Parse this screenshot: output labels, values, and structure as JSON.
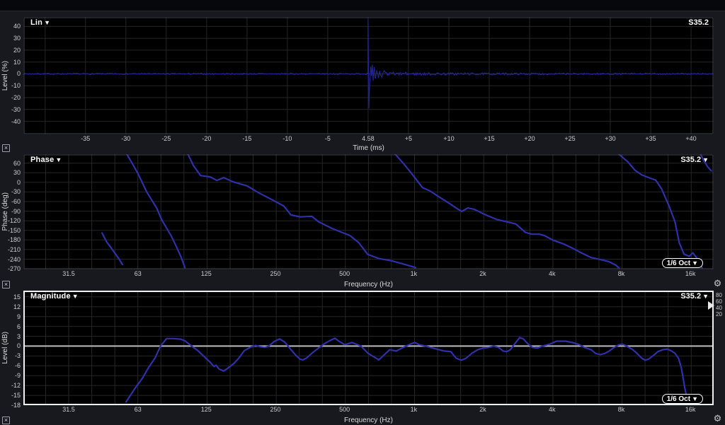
{
  "app": {
    "trace_label": "S35.2",
    "smoothing_label": "1/6 Oct",
    "glyphs": {
      "dropdown": "▼",
      "close": "×",
      "gear": "⚙"
    },
    "colors": {
      "grid": "#262626",
      "plot_border": "#41464e",
      "active_border": "#f0f0f0",
      "zero_line": "#bdbdbd",
      "ir_trace": "#24249c",
      "freq_trace": "#3030a8"
    }
  },
  "panels": {
    "ir": {
      "title": "Lin",
      "xlabel": "Time (ms)",
      "ylabel": "Level (%)",
      "trace": "S35.2"
    },
    "phase": {
      "title": "Phase",
      "xlabel": "Frequency (Hz)",
      "ylabel": "Phase (deg)",
      "trace": "S35.2",
      "smoothing": "1/6 Oct"
    },
    "magnitude": {
      "title": "Magnitude",
      "xlabel": "Frequency (Hz)",
      "ylabel": "Level (dB)",
      "trace": "S35.2",
      "smoothing": "1/6 Oct",
      "right_scale": [
        "80",
        "60",
        "40",
        "20"
      ]
    }
  },
  "chart_data": [
    {
      "id": "ir",
      "type": "line",
      "title": "Lin (impulse response)",
      "xscale": "linear",
      "xlim": [
        -42.7,
        42.8
      ],
      "ylim": [
        -51,
        48
      ],
      "xlabel": "Time (ms)",
      "ylabel": "Level (%)",
      "grid_x_step": 5,
      "xticks": [
        {
          "v": -35,
          "l": "-35"
        },
        {
          "v": -30,
          "l": "-30"
        },
        {
          "v": -25,
          "l": "-25"
        },
        {
          "v": -20,
          "l": "-20"
        },
        {
          "v": -15,
          "l": "-15"
        },
        {
          "v": -10,
          "l": "-10"
        },
        {
          "v": -5,
          "l": "-5"
        },
        {
          "v": 0,
          "l": "4.58"
        },
        {
          "v": 5,
          "l": "+5"
        },
        {
          "v": 10,
          "l": "+10"
        },
        {
          "v": 15,
          "l": "+15"
        },
        {
          "v": 20,
          "l": "+20"
        },
        {
          "v": 25,
          "l": "+25"
        },
        {
          "v": 30,
          "l": "+30"
        },
        {
          "v": 35,
          "l": "+35"
        },
        {
          "v": 40,
          "l": "+40"
        }
      ],
      "yticks": [
        40,
        30,
        20,
        10,
        0,
        -10,
        -20,
        -30,
        -40
      ],
      "stroke": "#24249c",
      "stroke_width": 1.1,
      "impulse": {
        "seed": 7,
        "dt": 0.09,
        "noise_pre": 0.55,
        "noise_post": 1.15,
        "decay_ms": 14,
        "peak_time_label": "4.58",
        "keypoints": [
          [
            -0.15,
            0
          ],
          [
            -0.02,
            2
          ],
          [
            0,
            46
          ],
          [
            0.05,
            5
          ],
          [
            0.1,
            -29
          ],
          [
            0.18,
            -12
          ],
          [
            0.25,
            -2
          ],
          [
            0.33,
            5
          ],
          [
            0.42,
            -3
          ],
          [
            0.52,
            7
          ],
          [
            0.62,
            -5
          ],
          [
            0.75,
            6
          ],
          [
            0.9,
            -4
          ],
          [
            1.05,
            3
          ],
          [
            1.25,
            -2.5
          ],
          [
            1.45,
            2.5
          ],
          [
            1.7,
            -2
          ],
          [
            2.0,
            2
          ],
          [
            2.4,
            -1.5
          ],
          [
            2.9,
            1.2
          ],
          [
            3.4,
            -1
          ]
        ]
      }
    },
    {
      "id": "phase",
      "type": "line",
      "title": "Phase",
      "xscale": "log",
      "xlim": [
        20,
        20200
      ],
      "ylim": [
        -272,
        88
      ],
      "xlabel": "Frequency (Hz)",
      "ylabel": "Phase (deg)",
      "xticks": [
        {
          "v": 31.5,
          "l": "31.5"
        },
        {
          "v": 63,
          "l": "63"
        },
        {
          "v": 125,
          "l": "125"
        },
        {
          "v": 250,
          "l": "250"
        },
        {
          "v": 500,
          "l": "500"
        },
        {
          "v": 1000,
          "l": "1k"
        },
        {
          "v": 2000,
          "l": "2k"
        },
        {
          "v": 4000,
          "l": "4k"
        },
        {
          "v": 8000,
          "l": "8k"
        },
        {
          "v": 16000,
          "l": "16k"
        }
      ],
      "yticks": [
        60,
        30,
        0,
        -30,
        -60,
        -90,
        -120,
        -150,
        -180,
        -210,
        -240,
        -270
      ],
      "stroke": "#3030a8",
      "stroke_width": 2.2,
      "segments": [
        [
          [
            44,
            -158
          ],
          [
            46,
            -185
          ],
          [
            49,
            -212
          ],
          [
            52,
            -238
          ],
          [
            54,
            -257
          ]
        ],
        [
          [
            56,
            92
          ],
          [
            60,
            55
          ],
          [
            63,
            28
          ],
          [
            69,
            -31
          ],
          [
            76,
            -80
          ],
          [
            80,
            -117
          ],
          [
            88,
            -167
          ],
          [
            93,
            -203
          ],
          [
            97,
            -232
          ],
          [
            101,
            -266
          ]
        ],
        [
          [
            104,
            88
          ],
          [
            110,
            52
          ],
          [
            118,
            21
          ],
          [
            130,
            17
          ],
          [
            139,
            6
          ],
          [
            149,
            15
          ],
          [
            163,
            2
          ],
          [
            188,
            -11
          ],
          [
            212,
            -33
          ],
          [
            249,
            -59
          ],
          [
            272,
            -74
          ],
          [
            292,
            -102
          ],
          [
            321,
            -108
          ],
          [
            360,
            -106
          ],
          [
            385,
            -123
          ],
          [
            444,
            -145
          ],
          [
            527,
            -166
          ],
          [
            576,
            -188
          ],
          [
            630,
            -225
          ],
          [
            706,
            -238
          ],
          [
            810,
            -246
          ],
          [
            900,
            -255
          ],
          [
            1018,
            -266
          ]
        ],
        [
          [
            830,
            88
          ],
          [
            900,
            60
          ],
          [
            990,
            23
          ],
          [
            1090,
            -16
          ],
          [
            1170,
            -26
          ],
          [
            1280,
            -44
          ],
          [
            1410,
            -63
          ],
          [
            1560,
            -84
          ],
          [
            1620,
            -91
          ],
          [
            1720,
            -80
          ],
          [
            1830,
            -84
          ],
          [
            2050,
            -101
          ],
          [
            2300,
            -116
          ],
          [
            2530,
            -123
          ],
          [
            2780,
            -130
          ],
          [
            3060,
            -156
          ],
          [
            3260,
            -162
          ],
          [
            3520,
            -162
          ],
          [
            3700,
            -166
          ],
          [
            4050,
            -181
          ],
          [
            4480,
            -192
          ],
          [
            4890,
            -205
          ],
          [
            5360,
            -220
          ],
          [
            5920,
            -235
          ],
          [
            6480,
            -241
          ],
          [
            7090,
            -248
          ],
          [
            7600,
            -259
          ],
          [
            7820,
            -268
          ]
        ],
        [
          [
            7820,
            88
          ],
          [
            8550,
            64
          ],
          [
            9170,
            38
          ],
          [
            9830,
            23
          ],
          [
            10700,
            13
          ],
          [
            11300,
            7
          ],
          [
            12000,
            -21
          ],
          [
            12900,
            -73
          ],
          [
            13700,
            -123
          ],
          [
            14300,
            -188
          ],
          [
            15000,
            -224
          ],
          [
            15800,
            -231
          ],
          [
            16400,
            -220
          ],
          [
            17000,
            -235
          ],
          [
            17600,
            -253
          ],
          [
            18000,
            -268
          ]
        ],
        [
          [
            17700,
            88
          ],
          [
            18300,
            68
          ],
          [
            19000,
            49
          ],
          [
            19700,
            36
          ]
        ]
      ]
    },
    {
      "id": "magnitude",
      "type": "line",
      "title": "Magnitude",
      "xscale": "log",
      "xlim": [
        20,
        20200
      ],
      "ylim": [
        -18,
        16.9
      ],
      "xlabel": "Frequency (Hz)",
      "ylabel": "Level (dB)",
      "zero_line": true,
      "xticks": [
        {
          "v": 31.5,
          "l": "31.5"
        },
        {
          "v": 63,
          "l": "63"
        },
        {
          "v": 125,
          "l": "125"
        },
        {
          "v": 250,
          "l": "250"
        },
        {
          "v": 500,
          "l": "500"
        },
        {
          "v": 1000,
          "l": "1k"
        },
        {
          "v": 2000,
          "l": "2k"
        },
        {
          "v": 4000,
          "l": "4k"
        },
        {
          "v": 8000,
          "l": "8k"
        },
        {
          "v": 16000,
          "l": "16k"
        }
      ],
      "yticks": [
        15,
        12,
        9,
        6,
        3,
        0,
        -3,
        -6,
        -9,
        -12,
        -15,
        -18
      ],
      "stroke": "#3030a8",
      "stroke_width": 2.2,
      "active": true,
      "segments": [
        [
          [
            56,
            -17
          ],
          [
            61,
            -13
          ],
          [
            66,
            -9.7
          ],
          [
            70,
            -6.6
          ],
          [
            75,
            -3.5
          ],
          [
            79,
            0
          ],
          [
            84,
            2.3
          ],
          [
            90,
            2.3
          ],
          [
            97,
            2.1
          ],
          [
            101,
            1.6
          ],
          [
            108,
            0
          ],
          [
            115,
            -1.4
          ],
          [
            122,
            -3.1
          ],
          [
            130,
            -4.9
          ],
          [
            135,
            -6.2
          ],
          [
            138,
            -5.8
          ],
          [
            142,
            -7
          ],
          [
            149,
            -7.6
          ],
          [
            156,
            -6.6
          ],
          [
            165,
            -5.3
          ],
          [
            174,
            -3.5
          ],
          [
            183,
            -1.4
          ],
          [
            195,
            -0.3
          ],
          [
            205,
            0.2
          ],
          [
            215,
            -0.2
          ],
          [
            225,
            -0.4
          ],
          [
            234,
            0
          ],
          [
            247,
            1.4
          ],
          [
            261,
            2.2
          ],
          [
            275,
            1.2
          ],
          [
            290,
            -0.8
          ],
          [
            305,
            -2.6
          ],
          [
            320,
            -4
          ],
          [
            330,
            -4.2
          ],
          [
            342,
            -3.6
          ],
          [
            360,
            -2.2
          ],
          [
            385,
            -0.6
          ],
          [
            410,
            0.8
          ],
          [
            435,
            1.8
          ],
          [
            454,
            2.4
          ],
          [
            470,
            1.6
          ],
          [
            501,
            0.4
          ],
          [
            538,
            1.1
          ],
          [
            589,
            0
          ],
          [
            633,
            -2.2
          ],
          [
            705,
            -4.2
          ],
          [
            785,
            -1.1
          ],
          [
            840,
            -1.5
          ],
          [
            900,
            -0.4
          ],
          [
            965,
            0.6
          ],
          [
            1010,
            1.1
          ],
          [
            1060,
            0.4
          ],
          [
            1130,
            0
          ],
          [
            1210,
            -0.6
          ],
          [
            1290,
            -1.1
          ],
          [
            1360,
            -1.5
          ],
          [
            1450,
            -1.7
          ],
          [
            1530,
            -3.7
          ],
          [
            1610,
            -4.3
          ],
          [
            1690,
            -3.7
          ],
          [
            1790,
            -2.2
          ],
          [
            1900,
            -1.1
          ],
          [
            2000,
            -0.6
          ],
          [
            2120,
            -0.4
          ],
          [
            2230,
            0
          ],
          [
            2340,
            -0.4
          ],
          [
            2450,
            -1.5
          ],
          [
            2540,
            -1.7
          ],
          [
            2630,
            -1.1
          ],
          [
            2780,
            1.1
          ],
          [
            2890,
            2.6
          ],
          [
            3000,
            2.2
          ],
          [
            3150,
            0.6
          ],
          [
            3290,
            -0.4
          ],
          [
            3450,
            -0.6
          ],
          [
            3630,
            0
          ],
          [
            3900,
            0.6
          ],
          [
            4180,
            1.5
          ],
          [
            4360,
            1.5
          ],
          [
            4580,
            1.5
          ],
          [
            4900,
            1.1
          ],
          [
            5270,
            0.4
          ],
          [
            5530,
            -0.4
          ],
          [
            5920,
            -1.1
          ],
          [
            6180,
            -2.2
          ],
          [
            6480,
            -2.6
          ],
          [
            6800,
            -2.2
          ],
          [
            7090,
            -1.5
          ],
          [
            7450,
            -0.4
          ],
          [
            7820,
            0.4
          ],
          [
            8100,
            0.6
          ],
          [
            8440,
            0
          ],
          [
            8990,
            -1.1
          ],
          [
            9370,
            -2.2
          ],
          [
            9830,
            -3.7
          ],
          [
            10180,
            -4.3
          ],
          [
            10540,
            -3.9
          ],
          [
            11070,
            -2.8
          ],
          [
            11540,
            -1.7
          ],
          [
            12100,
            -1.1
          ],
          [
            12700,
            -0.9
          ],
          [
            13250,
            -1.5
          ],
          [
            13710,
            -2.2
          ],
          [
            14200,
            -3.7
          ],
          [
            14600,
            -6.5
          ],
          [
            14900,
            -10.1
          ],
          [
            15200,
            -13.6
          ],
          [
            15650,
            -17.2
          ],
          [
            15900,
            -19.5
          ]
        ]
      ]
    }
  ]
}
